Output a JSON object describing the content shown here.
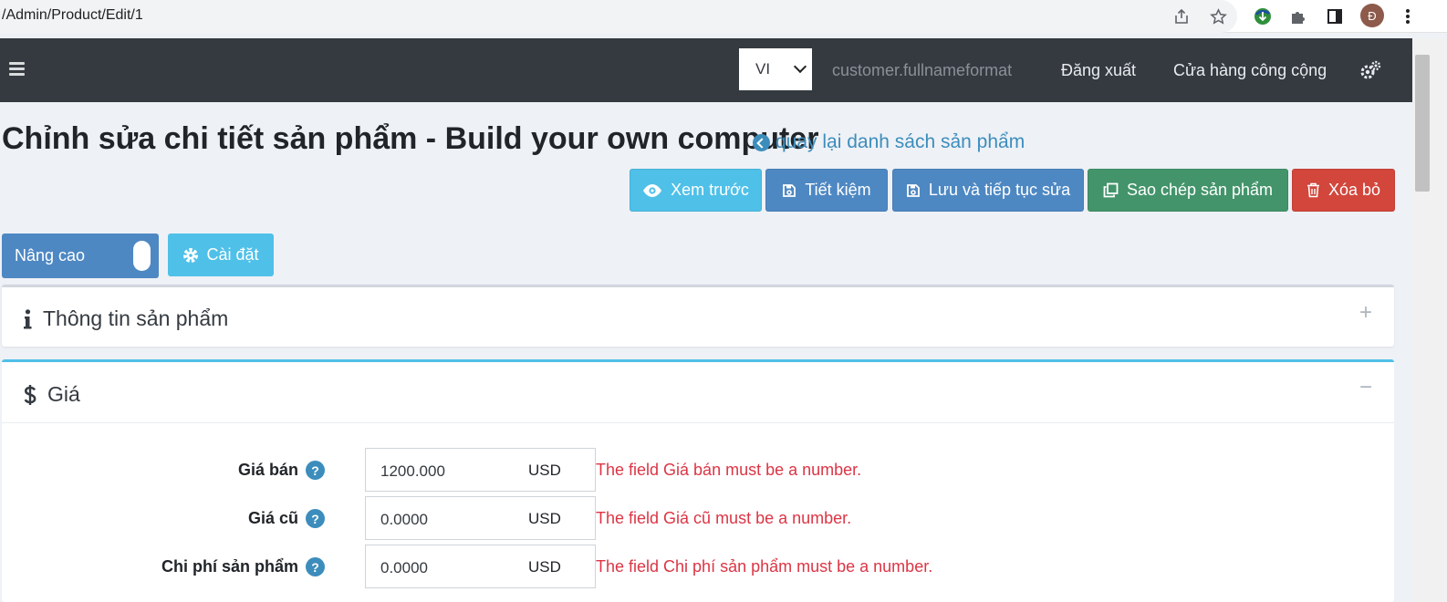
{
  "browser": {
    "url": "/Admin/Product/Edit/1",
    "avatar_letter": "Đ"
  },
  "header": {
    "language": "VI",
    "user_name": "customer.fullnameformat",
    "logout": "Đăng xuất",
    "public_store": "Cửa hàng công cộng"
  },
  "page": {
    "title": "Chỉnh sửa chi tiết sản phẩm - Build your own computer",
    "back_link": "quay lại danh sách sản phẩm"
  },
  "actions": {
    "preview": "Xem trước",
    "save": "Tiết kiệm",
    "save_continue": "Lưu và tiếp tục sửa",
    "copy": "Sao chép sản phẩm",
    "delete": "Xóa bỏ"
  },
  "mode": {
    "advanced": "Nâng cao",
    "settings": "Cài đặt"
  },
  "panels": {
    "info": {
      "title": "Thông tin sản phẩm",
      "tool": "+"
    },
    "price": {
      "title": "Giá",
      "tool": "−"
    }
  },
  "price_fields": [
    {
      "label": "Giá bán",
      "value": "1200.000",
      "unit": "USD",
      "error": "The field Giá bán must be a number."
    },
    {
      "label": "Giá cũ",
      "value": "0.0000",
      "unit": "USD",
      "error": "The field Giá cũ must be a number."
    },
    {
      "label": "Chi phí sản phẩm",
      "value": "0.0000",
      "unit": "USD",
      "error": "The field Chi phí sản phẩm must be a number."
    }
  ],
  "colors": {
    "info": "#4fc0e8",
    "primary": "#4e88c3",
    "success": "#43946b",
    "danger": "#d2463b",
    "error_text": "#dc3545",
    "header_bg": "#343a40"
  }
}
